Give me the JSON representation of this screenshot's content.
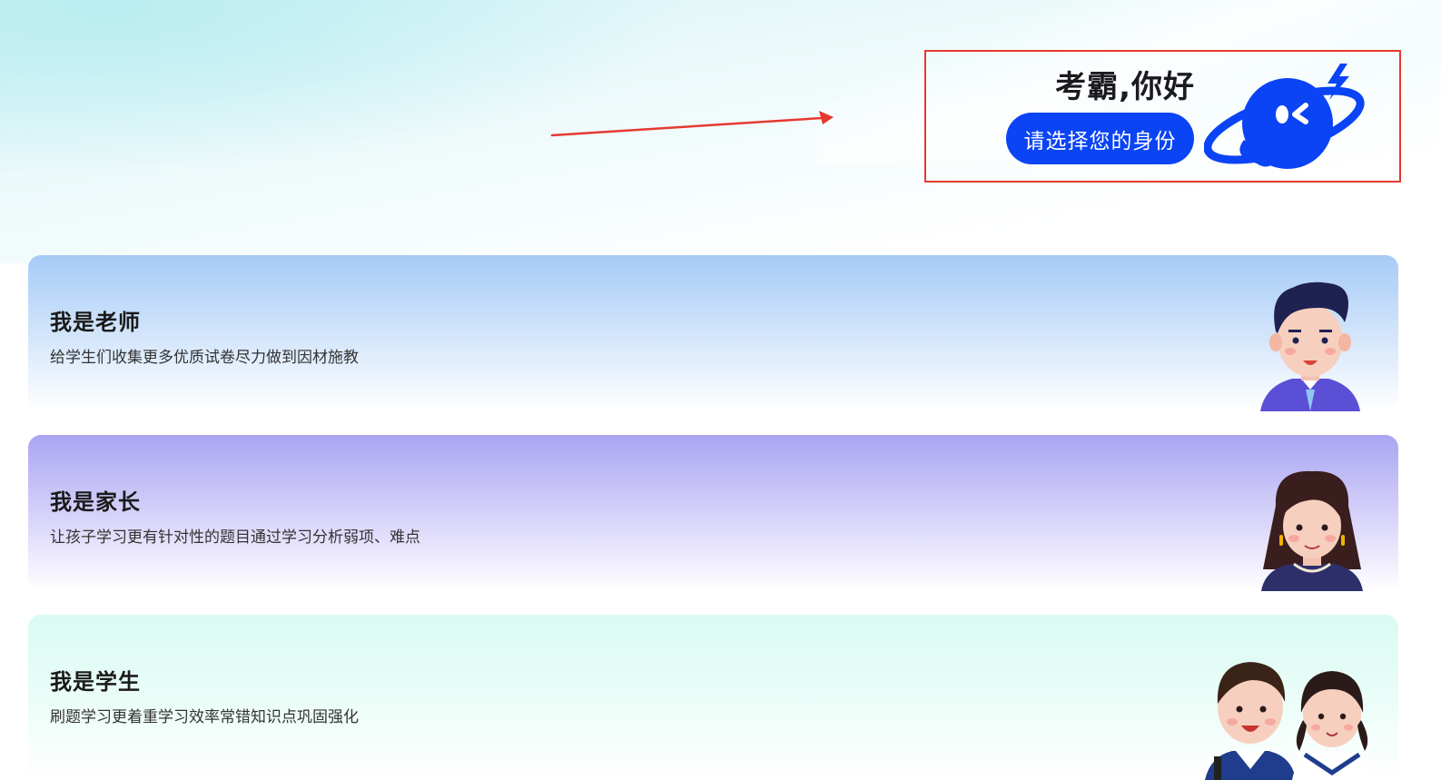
{
  "header": {
    "greeting": "考霸,你好",
    "choose_identity_button": "请选择您的身份"
  },
  "roles": [
    {
      "title": "我是老师",
      "description": "给学生们收集更多优质试卷尽力做到因材施教",
      "avatar_icon": "teacher-avatar"
    },
    {
      "title": "我是家长",
      "description": "让孩子学习更有针对性的题目通过学习分析弱项、难点",
      "avatar_icon": "parent-avatar"
    },
    {
      "title": "我是学生",
      "description": "刷题学习更着重学习效率常错知识点巩固强化",
      "avatar_icon": "students-avatar"
    }
  ],
  "colors": {
    "primary_button": "#0a44f5",
    "annotation_red": "#e53930",
    "teacher_card": "#a6cbf6",
    "parent_card": "#aaa5f2",
    "student_card": "#d9fbf2"
  }
}
